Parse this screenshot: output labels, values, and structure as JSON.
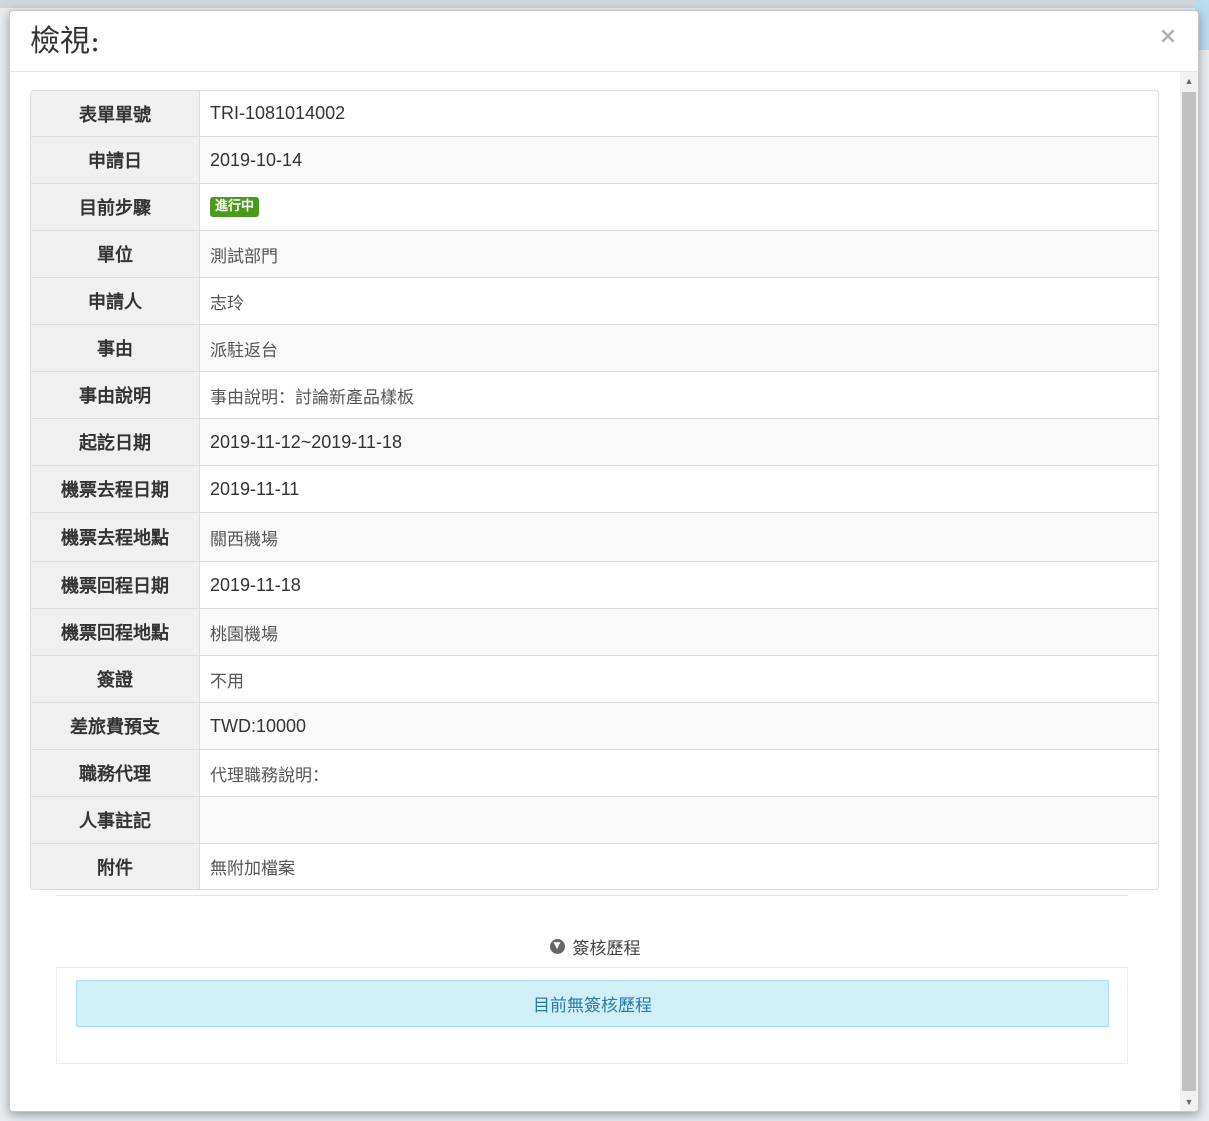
{
  "modal": {
    "title": "檢視:",
    "close_label": "×"
  },
  "fields": [
    {
      "label": "表單單號",
      "value": "TRI-1081014002"
    },
    {
      "label": "申請日",
      "value": "2019-10-14"
    },
    {
      "label": "目前步驟",
      "value": "進行中",
      "badge": true,
      "badge_color": "#4a9a1c"
    },
    {
      "label": "單位",
      "value": "測試部門"
    },
    {
      "label": "申請人",
      "value": "志玲"
    },
    {
      "label": "事由",
      "value": "派駐返台"
    },
    {
      "label": "事由說明",
      "value": "事由說明：討論新產品樣板"
    },
    {
      "label": "起訖日期",
      "value": "2019-11-12~2019-11-18"
    },
    {
      "label": "機票去程日期",
      "value": "2019-11-11"
    },
    {
      "label": "機票去程地點",
      "value": "關西機場"
    },
    {
      "label": "機票回程日期",
      "value": "2019-11-18"
    },
    {
      "label": "機票回程地點",
      "value": "桃園機場"
    },
    {
      "label": "簽證",
      "value": "不用"
    },
    {
      "label": "差旅費預支",
      "value": "TWD:10000"
    },
    {
      "label": "職務代理",
      "value": "代理職務說明："
    },
    {
      "label": "人事註記",
      "value": ""
    },
    {
      "label": "附件",
      "value": "無附加檔案"
    }
  ],
  "history": {
    "toggle_label": "簽核歷程",
    "toggle_icon": "chevron-circle-down-icon",
    "empty_message": "目前無簽核歷程"
  },
  "colors": {
    "badge": "#4a9a1c",
    "alert_bg": "#d0eff9",
    "alert_text": "#2a7aa7"
  }
}
